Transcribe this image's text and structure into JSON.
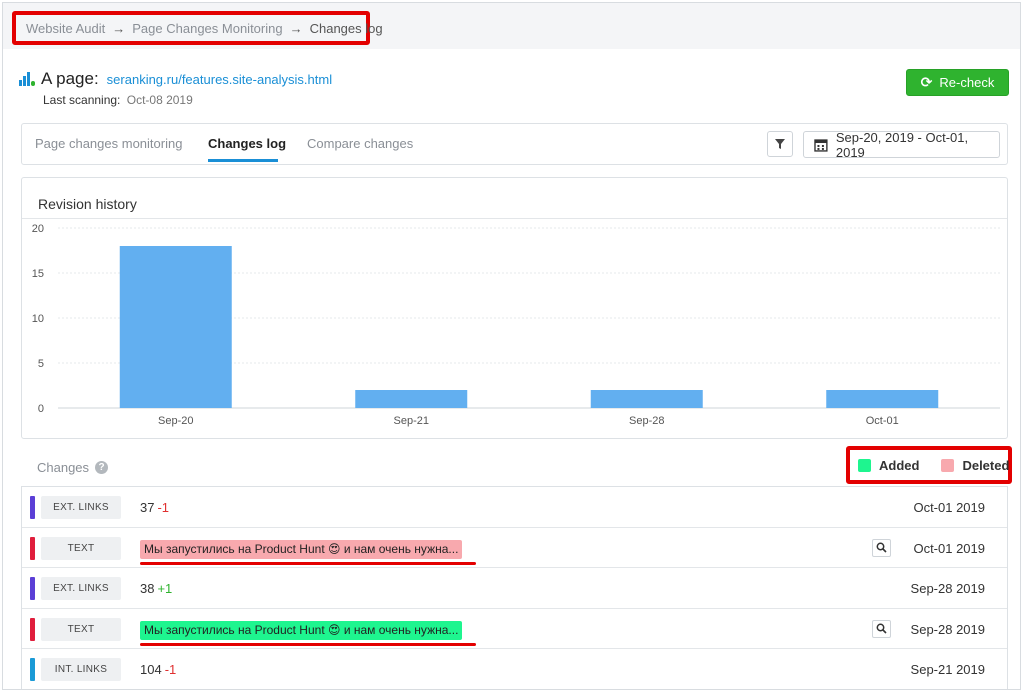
{
  "breadcrumb": {
    "items": [
      "Website Audit",
      "Page Changes Monitoring",
      "Changes log"
    ],
    "separator": "→"
  },
  "page": {
    "label": "A page:",
    "url": "seranking.ru/features.site-analysis.html",
    "last_scanning_label": "Last scanning:",
    "last_scanning_value": "Oct-08 2019"
  },
  "recheck": {
    "label": "Re-check",
    "icon": "refresh-icon",
    "color": "#2fb32f"
  },
  "tabs": [
    {
      "label": "Page changes monitoring",
      "active": false
    },
    {
      "label": "Changes log",
      "active": true
    },
    {
      "label": "Compare changes",
      "active": false
    }
  ],
  "filter": {
    "icon": "filter-icon"
  },
  "date_range": {
    "icon": "calendar-icon",
    "value": "Sep-20, 2019 - Oct-01, 2019"
  },
  "chart_data": {
    "type": "bar",
    "title": "Revision history",
    "categories": [
      "Sep-20",
      "Sep-21",
      "Sep-28",
      "Oct-01"
    ],
    "values": [
      18,
      2,
      2,
      2
    ],
    "ylim": [
      0,
      20
    ],
    "yticks": [
      0,
      5,
      10,
      15,
      20
    ],
    "grid": true,
    "bar_color": "#62aff0"
  },
  "changes": {
    "label": "Changes",
    "legend": [
      {
        "label": "Added",
        "color": "#1ef58f"
      },
      {
        "label": "Deleted",
        "color": "#f8a9ae"
      }
    ],
    "rows": [
      {
        "type": "EXT. LINKS",
        "stripe": "#5b3fd6",
        "value": "37",
        "delta": "-1",
        "date": "Oct-01 2019"
      },
      {
        "type": "TEXT",
        "stripe": "#e01e3c",
        "text": "Мы запустились на Product Hunt 😍 и нам очень нужна...",
        "status": "deleted",
        "date": "Oct-01 2019"
      },
      {
        "type": "EXT. LINKS",
        "stripe": "#5b3fd6",
        "value": "38",
        "delta": "+1",
        "date": "Sep-28 2019"
      },
      {
        "type": "TEXT",
        "stripe": "#e01e3c",
        "text": "Мы запустились на Product Hunt 😍 и нам очень нужна...",
        "status": "added",
        "date": "Sep-28 2019"
      },
      {
        "type": "INT. LINKS",
        "stripe": "#1a9ad6",
        "value": "104",
        "delta": "-1",
        "date": "Sep-21 2019"
      }
    ]
  }
}
